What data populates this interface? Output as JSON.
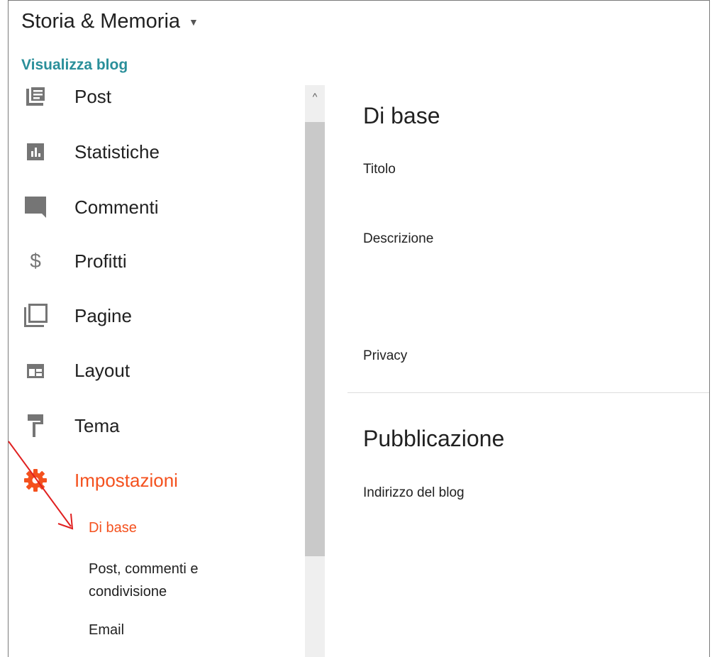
{
  "header": {
    "blog_title": "Storia & Memoria",
    "view_blog": "Visualizza blog"
  },
  "sidebar": {
    "items": [
      {
        "label": "Post",
        "icon": "posts-icon"
      },
      {
        "label": "Statistiche",
        "icon": "stats-icon"
      },
      {
        "label": "Commenti",
        "icon": "comments-icon"
      },
      {
        "label": "Profitti",
        "icon": "dollar-icon"
      },
      {
        "label": "Pagine",
        "icon": "pages-icon"
      },
      {
        "label": "Layout",
        "icon": "layout-icon"
      },
      {
        "label": "Tema",
        "icon": "paint-roller-icon"
      },
      {
        "label": "Impostazioni",
        "icon": "gear-icon",
        "active": true
      }
    ],
    "subitems": [
      {
        "label": "Di base",
        "active": true
      },
      {
        "label": "Post, commenti e condivisione"
      },
      {
        "label": "Email"
      }
    ]
  },
  "main": {
    "sections": [
      {
        "title": "Di base",
        "fields": [
          "Titolo",
          "Descrizione",
          "Privacy"
        ]
      },
      {
        "title": "Pubblicazione",
        "fields": [
          "Indirizzo del blog"
        ]
      }
    ]
  },
  "colors": {
    "accent": "#f4511e",
    "link": "#2a8f9a",
    "icon": "#757575",
    "annotation_arrow": "#e02020"
  }
}
